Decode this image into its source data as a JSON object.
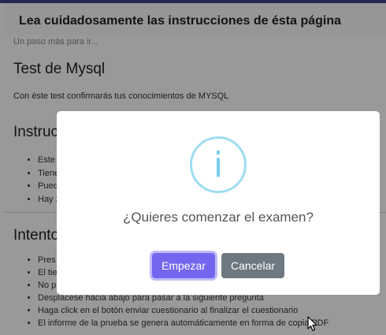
{
  "page": {
    "title": "Lea cuidadosamente las instrucciones de ésta página",
    "subtitle": "Un paso más para ir...",
    "test_heading": "Test de Mysql",
    "test_description": "Con éste test confirmarás tus conocimientos de MYSQL",
    "instructions_heading": "Instruc",
    "instructions_items": [
      "Este",
      "Tiene",
      "Pued",
      "Hay 2"
    ],
    "attempts_heading": "Intento",
    "attempts_items": [
      "Pres",
      "El tie",
      "No p",
      "Desplácese hacia abajo para pasar a la siguiente pregunta",
      "Haga click en el botón enviar cuestionario al finalizar el cuestionario",
      "El informe de la prueba se genera automáticamente en forma de copia PDF"
    ]
  },
  "modal": {
    "icon": "info-icon",
    "icon_glyph": "i",
    "question": "¿Quieres comenzar el examen?",
    "confirm_label": "Empezar",
    "cancel_label": "Cancelar"
  },
  "colors": {
    "confirm": "#7367f0",
    "cancel": "#6e7881",
    "info_ring": "#9fdcf1",
    "top_bar": "#3f4588"
  }
}
